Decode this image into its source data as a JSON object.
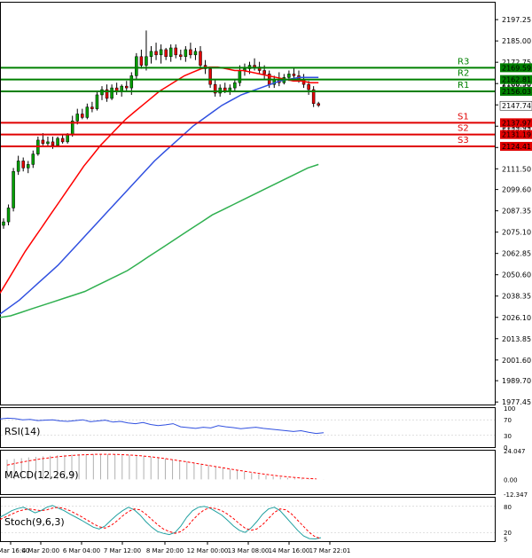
{
  "chart_data": [
    {
      "type": "candlestick",
      "panel": "main",
      "y_ticks": [
        2197.25,
        2185.0,
        2172.75,
        2160.5,
        2148.25,
        2136.0,
        2123.75,
        2111.5,
        2099.6,
        2087.35,
        2075.1,
        2062.85,
        2050.6,
        2038.35,
        2026.1,
        2013.85,
        2001.6,
        1989.7,
        1977.45
      ],
      "ylim": [
        1976.0,
        2207.0
      ],
      "x_ticks": [
        "5 Mar 16:00",
        "4 Mar 20:00",
        "6 Mar 04:00",
        "7 Mar 12:00",
        "8 Mar 20:00",
        "12 Mar 00:00",
        "13 Mar 08:00",
        "14 Mar 16:00",
        "17 Mar 22:01"
      ],
      "candles": [
        {
          "o": 2079,
          "h": 2083,
          "l": 2077,
          "c": 2081
        },
        {
          "o": 2081,
          "h": 2091,
          "l": 2079,
          "c": 2089
        },
        {
          "o": 2089,
          "h": 2112,
          "l": 2087,
          "c": 2110
        },
        {
          "o": 2110,
          "h": 2119,
          "l": 2108,
          "c": 2116
        },
        {
          "o": 2116,
          "h": 2118,
          "l": 2110,
          "c": 2112
        },
        {
          "o": 2112,
          "h": 2116,
          "l": 2109,
          "c": 2114
        },
        {
          "o": 2114,
          "h": 2122,
          "l": 2112,
          "c": 2120
        },
        {
          "o": 2120,
          "h": 2130,
          "l": 2119,
          "c": 2128
        },
        {
          "o": 2128,
          "h": 2132,
          "l": 2125,
          "c": 2126
        },
        {
          "o": 2126,
          "h": 2130,
          "l": 2124,
          "c": 2127
        },
        {
          "o": 2127,
          "h": 2130,
          "l": 2123,
          "c": 2125
        },
        {
          "o": 2125,
          "h": 2130,
          "l": 2124,
          "c": 2129
        },
        {
          "o": 2129,
          "h": 2131,
          "l": 2126,
          "c": 2127
        },
        {
          "o": 2127,
          "h": 2132,
          "l": 2126,
          "c": 2131
        },
        {
          "o": 2131,
          "h": 2142,
          "l": 2130,
          "c": 2139
        },
        {
          "o": 2139,
          "h": 2146,
          "l": 2137,
          "c": 2143
        },
        {
          "o": 2143,
          "h": 2146,
          "l": 2140,
          "c": 2141
        },
        {
          "o": 2141,
          "h": 2149,
          "l": 2140,
          "c": 2147
        },
        {
          "o": 2147,
          "h": 2150,
          "l": 2144,
          "c": 2146
        },
        {
          "o": 2146,
          "h": 2156,
          "l": 2145,
          "c": 2154
        },
        {
          "o": 2154,
          "h": 2159,
          "l": 2151,
          "c": 2157
        },
        {
          "o": 2157,
          "h": 2160,
          "l": 2150,
          "c": 2152
        },
        {
          "o": 2152,
          "h": 2160,
          "l": 2151,
          "c": 2158
        },
        {
          "o": 2158,
          "h": 2161,
          "l": 2154,
          "c": 2156
        },
        {
          "o": 2156,
          "h": 2160,
          "l": 2153,
          "c": 2159
        },
        {
          "o": 2159,
          "h": 2162,
          "l": 2156,
          "c": 2158
        },
        {
          "o": 2158,
          "h": 2167,
          "l": 2154,
          "c": 2165
        },
        {
          "o": 2165,
          "h": 2178,
          "l": 2163,
          "c": 2176
        },
        {
          "o": 2176,
          "h": 2180,
          "l": 2169,
          "c": 2171
        },
        {
          "o": 2171,
          "h": 2191,
          "l": 2168,
          "c": 2176
        },
        {
          "o": 2176,
          "h": 2182,
          "l": 2172,
          "c": 2179
        },
        {
          "o": 2179,
          "h": 2184,
          "l": 2174,
          "c": 2177
        },
        {
          "o": 2177,
          "h": 2183,
          "l": 2172,
          "c": 2180
        },
        {
          "o": 2180,
          "h": 2181,
          "l": 2174,
          "c": 2176
        },
        {
          "o": 2176,
          "h": 2183,
          "l": 2173,
          "c": 2181
        },
        {
          "o": 2181,
          "h": 2183,
          "l": 2175,
          "c": 2177
        },
        {
          "o": 2177,
          "h": 2180,
          "l": 2174,
          "c": 2176
        },
        {
          "o": 2176,
          "h": 2182,
          "l": 2173,
          "c": 2180
        },
        {
          "o": 2180,
          "h": 2184,
          "l": 2175,
          "c": 2177
        },
        {
          "o": 2177,
          "h": 2181,
          "l": 2174,
          "c": 2179
        },
        {
          "o": 2179,
          "h": 2182,
          "l": 2170,
          "c": 2171
        },
        {
          "o": 2171,
          "h": 2174,
          "l": 2166,
          "c": 2169
        },
        {
          "o": 2169,
          "h": 2170,
          "l": 2158,
          "c": 2160
        },
        {
          "o": 2160,
          "h": 2163,
          "l": 2153,
          "c": 2155
        },
        {
          "o": 2155,
          "h": 2160,
          "l": 2153,
          "c": 2158
        },
        {
          "o": 2158,
          "h": 2161,
          "l": 2155,
          "c": 2156
        },
        {
          "o": 2156,
          "h": 2160,
          "l": 2154,
          "c": 2158
        },
        {
          "o": 2158,
          "h": 2163,
          "l": 2156,
          "c": 2161
        },
        {
          "o": 2161,
          "h": 2171,
          "l": 2159,
          "c": 2168
        },
        {
          "o": 2168,
          "h": 2172,
          "l": 2165,
          "c": 2169
        },
        {
          "o": 2169,
          "h": 2173,
          "l": 2166,
          "c": 2171
        },
        {
          "o": 2171,
          "h": 2175,
          "l": 2168,
          "c": 2170
        },
        {
          "o": 2170,
          "h": 2173,
          "l": 2166,
          "c": 2168
        },
        {
          "o": 2168,
          "h": 2171,
          "l": 2163,
          "c": 2166
        },
        {
          "o": 2166,
          "h": 2168,
          "l": 2158,
          "c": 2160
        },
        {
          "o": 2160,
          "h": 2165,
          "l": 2158,
          "c": 2163
        },
        {
          "o": 2163,
          "h": 2167,
          "l": 2159,
          "c": 2161
        },
        {
          "o": 2161,
          "h": 2166,
          "l": 2160,
          "c": 2164
        },
        {
          "o": 2164,
          "h": 2168,
          "l": 2162,
          "c": 2166
        },
        {
          "o": 2166,
          "h": 2170,
          "l": 2163,
          "c": 2165
        },
        {
          "o": 2165,
          "h": 2168,
          "l": 2161,
          "c": 2163
        },
        {
          "o": 2163,
          "h": 2166,
          "l": 2158,
          "c": 2160
        },
        {
          "o": 2160,
          "h": 2162,
          "l": 2154,
          "c": 2157
        },
        {
          "o": 2157,
          "h": 2159,
          "l": 2147,
          "c": 2149
        },
        {
          "o": 2149,
          "h": 2150,
          "l": 2147,
          "c": 2148
        }
      ],
      "moving_averages": [
        {
          "color": "#ff0000",
          "values": [
            2040,
            2048,
            2056,
            2064,
            2071,
            2078,
            2085,
            2092,
            2099,
            2106,
            2113,
            2119,
            2125,
            2130,
            2135,
            2140,
            2144,
            2148,
            2152,
            2156,
            2159,
            2162,
            2165,
            2167,
            2169,
            2170,
            2170,
            2169,
            2168,
            2168,
            2167,
            2166,
            2165,
            2164,
            2163,
            2162,
            2162,
            2161,
            2161
          ]
        },
        {
          "color": "#3050e0",
          "values": [
            2028,
            2032,
            2036,
            2041,
            2046,
            2051,
            2056,
            2062,
            2068,
            2074,
            2080,
            2086,
            2092,
            2098,
            2104,
            2110,
            2116,
            2121,
            2126,
            2131,
            2136,
            2140,
            2144,
            2148,
            2151,
            2154,
            2156,
            2158,
            2160,
            2162,
            2163,
            2164,
            2164,
            2164
          ]
        },
        {
          "color": "#30b050",
          "values": [
            2026,
            2027,
            2029,
            2031,
            2033,
            2035,
            2037,
            2039,
            2041,
            2044,
            2047,
            2050,
            2053,
            2057,
            2061,
            2065,
            2069,
            2073,
            2077,
            2081,
            2085,
            2088,
            2091,
            2094,
            2097,
            2100,
            2103,
            2106,
            2109,
            2112,
            2114
          ]
        }
      ],
      "resistance": [
        {
          "name": "R3",
          "value": 2169.59,
          "label": "2169.59"
        },
        {
          "name": "R2",
          "value": 2162.81,
          "label": "2162.81"
        },
        {
          "name": "R1",
          "value": 2156.03,
          "label": "2156.03"
        }
      ],
      "support": [
        {
          "name": "S1",
          "value": 2137.97,
          "label": "2137.97"
        },
        {
          "name": "S2",
          "value": 2131.19,
          "label": "2131.19"
        },
        {
          "name": "S3",
          "value": 2124.41,
          "label": "2124.41"
        }
      ],
      "current_price": {
        "value": 2147.74,
        "label": "2147.74"
      },
      "hidden_labels": [
        "2166.50",
        "2135.93"
      ]
    },
    {
      "type": "line",
      "panel": "rsi",
      "title": "RSI(14)",
      "y_ticks": [
        "100",
        "70",
        "30",
        "0"
      ],
      "ylim": [
        0,
        100
      ],
      "color": "#3050e0",
      "values": [
        72,
        74,
        73,
        70,
        71,
        68,
        69,
        70,
        67,
        66,
        68,
        70,
        65,
        67,
        69,
        64,
        66,
        62,
        60,
        63,
        58,
        55,
        57,
        60,
        52,
        50,
        48,
        51,
        49,
        55,
        52,
        50,
        47,
        49,
        51,
        48,
        46,
        44,
        42,
        40,
        42,
        38,
        35,
        37
      ]
    },
    {
      "type": "bar",
      "panel": "macd",
      "title": "MACD(12,26,9)",
      "y_ticks": [
        "24.047",
        "0.00",
        "-12.347"
      ],
      "ylim": [
        -12.347,
        24.047
      ],
      "bar_color": "#b0b0b0",
      "signal_color": "#ff0000",
      "values": [
        16.5,
        17.2,
        17.8,
        18.4,
        18.9,
        19.3,
        19.8,
        20.2,
        20.5,
        20.8,
        21.0,
        21.1,
        21.2,
        21.2,
        21.1,
        21.0,
        20.8,
        20.5,
        20.1,
        19.6,
        19.0,
        18.3,
        17.5,
        16.7,
        15.8,
        14.9,
        13.9,
        12.9,
        11.8,
        10.7,
        9.6,
        8.5,
        7.4,
        6.3,
        5.3,
        4.3,
        3.4,
        2.6,
        1.9,
        1.3,
        0.9,
        0.6,
        0.4,
        0.2,
        0.1
      ],
      "signal": [
        12.0,
        13.2,
        14.4,
        15.5,
        16.5,
        17.4,
        18.2,
        18.9,
        19.5,
        20.0,
        20.4,
        20.7,
        20.9,
        21.0,
        21.0,
        20.9,
        20.7,
        20.4,
        20.0,
        19.5,
        18.9,
        18.2,
        17.4,
        16.5,
        15.6,
        14.7,
        13.7,
        12.7,
        11.7,
        10.7,
        9.7,
        8.7,
        7.7,
        6.8,
        5.9,
        5.0,
        4.2,
        3.4,
        2.7,
        2.1,
        1.6,
        1.1,
        0.7,
        0.4
      ]
    },
    {
      "type": "line",
      "panel": "stoch",
      "title": "Stoch(9,6,3)",
      "y_ticks": [
        "80",
        "20",
        "5"
      ],
      "ylim": [
        0,
        100
      ],
      "k_color": "#20a0a0",
      "d_color": "#ff0000",
      "k": [
        55,
        62,
        70,
        75,
        78,
        72,
        65,
        70,
        78,
        82,
        76,
        70,
        62,
        55,
        48,
        40,
        32,
        28,
        35,
        48,
        60,
        70,
        78,
        72,
        60,
        45,
        32,
        22,
        18,
        15,
        20,
        35,
        55,
        70,
        78,
        80,
        76,
        68,
        60,
        48,
        35,
        25,
        20,
        30,
        45,
        62,
        74,
        78,
        70,
        55,
        40,
        25,
        12,
        6,
        5,
        8
      ],
      "d": [
        50,
        56,
        62,
        68,
        72,
        74,
        72,
        70,
        72,
        76,
        78,
        75,
        70,
        63,
        56,
        48,
        40,
        33,
        30,
        36,
        46,
        58,
        68,
        74,
        72,
        62,
        50,
        38,
        28,
        22,
        18,
        22,
        32,
        48,
        62,
        72,
        77,
        75,
        70,
        62,
        52,
        40,
        30,
        25,
        28,
        38,
        52,
        66,
        74,
        72,
        62,
        48,
        34,
        20,
        10,
        6
      ]
    }
  ]
}
